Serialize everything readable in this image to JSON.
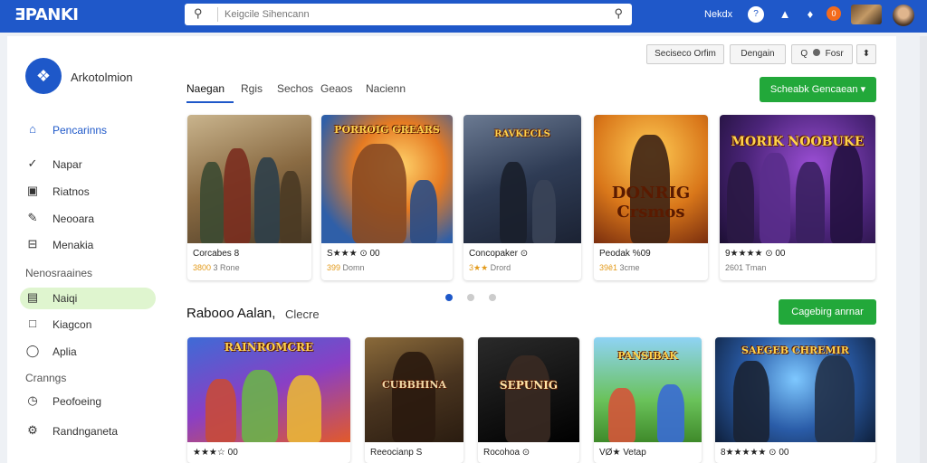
{
  "app": {
    "logo": "ƎPANKI"
  },
  "topbar": {
    "search_placeholder": "Keigcile Sihencann",
    "user_name": "Nekdx",
    "badge_count": "0",
    "icons": [
      "search-icon",
      "help-icon",
      "alert-icon",
      "bell-icon"
    ]
  },
  "sidebar": {
    "brand": "Arkotolmion",
    "items": [
      {
        "label": "Pencarinns",
        "icon": "home-icon",
        "primary": true
      },
      {
        "label": "Napar",
        "icon": "pin-icon"
      },
      {
        "label": "Riatnos",
        "icon": "puzzle-icon"
      },
      {
        "label": "Neooara",
        "icon": "edit-icon"
      },
      {
        "label": "Menakia",
        "icon": "minus-box-icon"
      }
    ],
    "section1": "Nenosraaines",
    "items2": [
      {
        "label": "Naiqi",
        "icon": "grid-icon",
        "active": true
      },
      {
        "label": "Kiagcon",
        "icon": "folder-icon"
      },
      {
        "label": "Aplia",
        "icon": "circle-icon"
      }
    ],
    "section2": "Cranngs",
    "items3": [
      {
        "label": "Peofoeing",
        "icon": "clock-icon"
      },
      {
        "label": "Randnganeta",
        "icon": "gear-icon"
      }
    ]
  },
  "tabs": [
    "Naegan",
    "Rgis",
    "Sechos",
    "Geaos",
    "Nacienn"
  ],
  "header_buttons": {
    "b1": "Seciseco Orfim",
    "b2": "Dengain",
    "b3_q": "Q",
    "b3": "Fosr",
    "b4": "⬍",
    "green": "Scheabk Gencaean"
  },
  "cards_row1": [
    {
      "name": "Corcabes 8",
      "meta_gold": "3800",
      "meta": "3 Rone",
      "title": ""
    },
    {
      "name": "S★★★  ⊙ 00",
      "meta_gold": "399",
      "meta": "Domn",
      "title": "PORROIG GREARS"
    },
    {
      "name": "Concopaker  ⊙",
      "meta_gold": "3★★",
      "meta": "Drord",
      "title": "RAVKECLS"
    },
    {
      "name": "Peodak  %09",
      "meta_gold": "39ê1",
      "meta": "3cme",
      "title": "DONRIG Crsmos"
    },
    {
      "name": "9★★★★  ⊙ 00",
      "meta_gold": "",
      "meta": "2601 Tman",
      "title": "MORIK NOOBUKE"
    }
  ],
  "carousel_dots": 3,
  "section": {
    "title": "Rabooo Aalan,",
    "sub": "Clecre",
    "button": "Cagebirg anrnar"
  },
  "cards_row2": [
    {
      "name": "★★★☆ 00",
      "title": "RAINROMCRE"
    },
    {
      "name": "Reeocianp S",
      "title": "CUBBHINA"
    },
    {
      "name": "Rocohoa  ⊙",
      "title": "SEPUNIG"
    },
    {
      "name": "VØ★ Vetap",
      "title": "PANSIBAK"
    },
    {
      "name": "8★★★★★  ⊙ 00",
      "title": "SAEGEB CHREMIR"
    }
  ],
  "colors": {
    "brand_blue": "#1f58c9",
    "accent_green": "#22a83a",
    "active_bg": "#dff5cf"
  }
}
